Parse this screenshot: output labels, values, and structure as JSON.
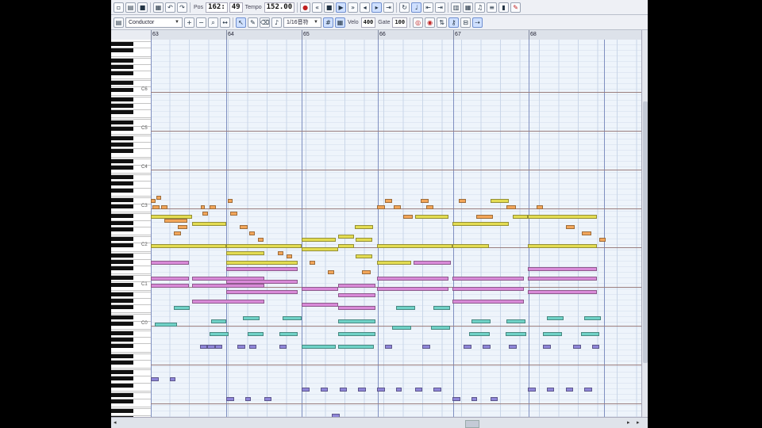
{
  "toolbar_top": {
    "position_label": "Pos",
    "position_value": "162:",
    "beat_value": "49",
    "tempo_label": "Tempo",
    "tempo_value": "152.00",
    "buttons": [
      "new-icon",
      "open-icon",
      "save-icon",
      "print-icon",
      "undo-icon",
      "redo-icon",
      "rewind-icon",
      "play-icon",
      "stop-icon",
      "record-icon",
      "loop-icon",
      "metronome-icon",
      "zoom-icon",
      "settings-icon"
    ]
  },
  "toolbar_second": {
    "track_select": "Conductor",
    "quantize_select": "1/16音符",
    "velocity_label": "Velo",
    "velocity_value": "400",
    "gate_label": "Gate",
    "gate_value": "100"
  },
  "ruler": {
    "measures": [
      "63",
      "64",
      "65",
      "66",
      "67",
      "68"
    ]
  },
  "keyboard": {
    "octave_labels": [
      "C6",
      "C5",
      "C4",
      "C3",
      "C2",
      "C1",
      "C0"
    ]
  },
  "colors": {
    "orange": "#f2a65a",
    "yellow": "#e3dc52",
    "pink": "#d98ad8",
    "teal": "#6fd2c7",
    "purple": "#8f86d8",
    "grid_bg": "#eef4fb",
    "measure_line": "#7f8fc0"
  },
  "notes": [
    {
      "track": "orange",
      "bar": 0.0,
      "len": 0.06,
      "pitch": 63
    },
    {
      "track": "orange",
      "bar": 0.07,
      "len": 0.07,
      "pitch": 64
    },
    {
      "track": "orange",
      "bar": 0.02,
      "len": 0.1,
      "pitch": 61
    },
    {
      "track": "orange",
      "bar": 0.14,
      "len": 0.08,
      "pitch": 61
    },
    {
      "track": "orange",
      "bar": 0.66,
      "len": 0.06,
      "pitch": 61
    },
    {
      "track": "orange",
      "bar": 0.18,
      "len": 0.3,
      "pitch": 57
    },
    {
      "track": "orange",
      "bar": 0.36,
      "len": 0.12,
      "pitch": 55
    },
    {
      "track": "orange",
      "bar": 0.3,
      "len": 0.1,
      "pitch": 53
    },
    {
      "track": "orange",
      "bar": 0.68,
      "len": 0.08,
      "pitch": 59
    },
    {
      "track": "orange",
      "bar": 0.78,
      "len": 0.08,
      "pitch": 61
    },
    {
      "track": "orange",
      "bar": 1.02,
      "len": 0.06,
      "pitch": 63
    },
    {
      "track": "orange",
      "bar": 1.05,
      "len": 0.1,
      "pitch": 59
    },
    {
      "track": "orange",
      "bar": 1.18,
      "len": 0.1,
      "pitch": 55
    },
    {
      "track": "orange",
      "bar": 1.3,
      "len": 0.08,
      "pitch": 53
    },
    {
      "track": "orange",
      "bar": 1.42,
      "len": 0.08,
      "pitch": 51
    },
    {
      "track": "orange",
      "bar": 1.55,
      "len": 0.08,
      "pitch": 49
    },
    {
      "track": "orange",
      "bar": 1.68,
      "len": 0.08,
      "pitch": 47
    },
    {
      "track": "orange",
      "bar": 1.8,
      "len": 0.07,
      "pitch": 46
    },
    {
      "track": "orange",
      "bar": 2.1,
      "len": 0.08,
      "pitch": 44
    },
    {
      "track": "orange",
      "bar": 2.35,
      "len": 0.08,
      "pitch": 41
    },
    {
      "track": "orange",
      "bar": 2.8,
      "len": 0.12,
      "pitch": 41
    },
    {
      "track": "orange",
      "bar": 3.0,
      "len": 0.1,
      "pitch": 61
    },
    {
      "track": "orange",
      "bar": 3.1,
      "len": 0.1,
      "pitch": 63
    },
    {
      "track": "orange",
      "bar": 3.22,
      "len": 0.1,
      "pitch": 61
    },
    {
      "track": "orange",
      "bar": 3.35,
      "len": 0.12,
      "pitch": 58
    },
    {
      "track": "orange",
      "bar": 3.58,
      "len": 0.1,
      "pitch": 63
    },
    {
      "track": "orange",
      "bar": 3.65,
      "len": 0.1,
      "pitch": 61
    },
    {
      "track": "orange",
      "bar": 4.08,
      "len": 0.1,
      "pitch": 63
    },
    {
      "track": "orange",
      "bar": 4.32,
      "len": 0.22,
      "pitch": 58
    },
    {
      "track": "orange",
      "bar": 4.55,
      "len": 0.1,
      "pitch": 56
    },
    {
      "track": "orange",
      "bar": 4.72,
      "len": 0.12,
      "pitch": 61
    },
    {
      "track": "orange",
      "bar": 5.12,
      "len": 0.08,
      "pitch": 61
    },
    {
      "track": "orange",
      "bar": 5.5,
      "len": 0.12,
      "pitch": 55
    },
    {
      "track": "orange",
      "bar": 5.72,
      "len": 0.12,
      "pitch": 53
    },
    {
      "track": "orange",
      "bar": 5.95,
      "len": 0.08,
      "pitch": 51
    },
    {
      "track": "yellow",
      "bar": 0.0,
      "len": 0.55,
      "pitch": 58
    },
    {
      "track": "yellow",
      "bar": 0.55,
      "len": 0.45,
      "pitch": 56
    },
    {
      "track": "yellow",
      "bar": 0.0,
      "len": 1.0,
      "pitch": 49
    },
    {
      "track": "yellow",
      "bar": 1.0,
      "len": 1.0,
      "pitch": 49
    },
    {
      "track": "yellow",
      "bar": 1.0,
      "len": 0.95,
      "pitch": 44
    },
    {
      "track": "yellow",
      "bar": 1.0,
      "len": 0.5,
      "pitch": 47
    },
    {
      "track": "yellow",
      "bar": 2.0,
      "len": 0.45,
      "pitch": 51
    },
    {
      "track": "yellow",
      "bar": 2.48,
      "len": 0.22,
      "pitch": 52
    },
    {
      "track": "yellow",
      "bar": 2.0,
      "len": 0.48,
      "pitch": 48
    },
    {
      "track": "yellow",
      "bar": 2.48,
      "len": 0.22,
      "pitch": 49
    },
    {
      "track": "yellow",
      "bar": 2.7,
      "len": 0.25,
      "pitch": 55
    },
    {
      "track": "yellow",
      "bar": 2.72,
      "len": 0.22,
      "pitch": 51
    },
    {
      "track": "yellow",
      "bar": 2.72,
      "len": 0.22,
      "pitch": 46
    },
    {
      "track": "yellow",
      "bar": 3.0,
      "len": 1.0,
      "pitch": 49
    },
    {
      "track": "yellow",
      "bar": 3.0,
      "len": 0.45,
      "pitch": 44
    },
    {
      "track": "yellow",
      "bar": 3.5,
      "len": 0.45,
      "pitch": 58
    },
    {
      "track": "yellow",
      "bar": 4.0,
      "len": 0.75,
      "pitch": 56
    },
    {
      "track": "yellow",
      "bar": 4.0,
      "len": 0.48,
      "pitch": 49
    },
    {
      "track": "yellow",
      "bar": 4.5,
      "len": 0.25,
      "pitch": 63
    },
    {
      "track": "yellow",
      "bar": 4.8,
      "len": 0.2,
      "pitch": 58
    },
    {
      "track": "yellow",
      "bar": 5.0,
      "len": 0.92,
      "pitch": 58
    },
    {
      "track": "yellow",
      "bar": 5.0,
      "len": 0.92,
      "pitch": 49
    },
    {
      "track": "pink",
      "bar": 0.0,
      "len": 0.5,
      "pitch": 44
    },
    {
      "track": "pink",
      "bar": 0.0,
      "len": 0.5,
      "pitch": 39
    },
    {
      "track": "pink",
      "bar": 0.0,
      "len": 0.5,
      "pitch": 37
    },
    {
      "track": "pink",
      "bar": 0.55,
      "len": 0.95,
      "pitch": 39
    },
    {
      "track": "pink",
      "bar": 0.55,
      "len": 0.95,
      "pitch": 37
    },
    {
      "track": "pink",
      "bar": 0.55,
      "len": 0.95,
      "pitch": 32
    },
    {
      "track": "pink",
      "bar": 1.0,
      "len": 0.95,
      "pitch": 42
    },
    {
      "track": "pink",
      "bar": 1.0,
      "len": 0.95,
      "pitch": 38
    },
    {
      "track": "pink",
      "bar": 1.0,
      "len": 0.95,
      "pitch": 35
    },
    {
      "track": "pink",
      "bar": 2.0,
      "len": 0.48,
      "pitch": 36
    },
    {
      "track": "pink",
      "bar": 2.0,
      "len": 0.48,
      "pitch": 31
    },
    {
      "track": "pink",
      "bar": 2.48,
      "len": 0.5,
      "pitch": 37
    },
    {
      "track": "pink",
      "bar": 2.48,
      "len": 0.5,
      "pitch": 34
    },
    {
      "track": "pink",
      "bar": 2.48,
      "len": 0.5,
      "pitch": 30
    },
    {
      "track": "pink",
      "bar": 3.0,
      "len": 0.95,
      "pitch": 39
    },
    {
      "track": "pink",
      "bar": 3.0,
      "len": 0.95,
      "pitch": 36
    },
    {
      "track": "pink",
      "bar": 3.48,
      "len": 0.5,
      "pitch": 44
    },
    {
      "track": "pink",
      "bar": 4.0,
      "len": 0.95,
      "pitch": 39
    },
    {
      "track": "pink",
      "bar": 4.0,
      "len": 0.95,
      "pitch": 36
    },
    {
      "track": "pink",
      "bar": 4.0,
      "len": 0.95,
      "pitch": 32
    },
    {
      "track": "pink",
      "bar": 5.0,
      "len": 0.92,
      "pitch": 42
    },
    {
      "track": "pink",
      "bar": 5.0,
      "len": 0.92,
      "pitch": 39
    },
    {
      "track": "pink",
      "bar": 5.0,
      "len": 0.92,
      "pitch": 35
    },
    {
      "track": "teal",
      "bar": 0.3,
      "len": 0.22,
      "pitch": 30
    },
    {
      "track": "teal",
      "bar": 0.05,
      "len": 0.3,
      "pitch": 25
    },
    {
      "track": "teal",
      "bar": 0.8,
      "len": 0.2,
      "pitch": 26
    },
    {
      "track": "teal",
      "bar": 0.78,
      "len": 0.25,
      "pitch": 22
    },
    {
      "track": "teal",
      "bar": 1.22,
      "len": 0.22,
      "pitch": 27
    },
    {
      "track": "teal",
      "bar": 1.28,
      "len": 0.22,
      "pitch": 22
    },
    {
      "track": "teal",
      "bar": 1.75,
      "len": 0.25,
      "pitch": 27
    },
    {
      "track": "teal",
      "bar": 1.7,
      "len": 0.25,
      "pitch": 22
    },
    {
      "track": "teal",
      "bar": 2.0,
      "len": 0.45,
      "pitch": 18
    },
    {
      "track": "teal",
      "bar": 2.48,
      "len": 0.5,
      "pitch": 26
    },
    {
      "track": "teal",
      "bar": 2.48,
      "len": 0.5,
      "pitch": 22
    },
    {
      "track": "teal",
      "bar": 2.48,
      "len": 0.48,
      "pitch": 18
    },
    {
      "track": "teal",
      "bar": 3.25,
      "len": 0.25,
      "pitch": 30
    },
    {
      "track": "teal",
      "bar": 3.2,
      "len": 0.25,
      "pitch": 24
    },
    {
      "track": "teal",
      "bar": 3.75,
      "len": 0.22,
      "pitch": 30
    },
    {
      "track": "teal",
      "bar": 3.72,
      "len": 0.25,
      "pitch": 24
    },
    {
      "track": "teal",
      "bar": 4.25,
      "len": 0.25,
      "pitch": 26
    },
    {
      "track": "teal",
      "bar": 4.22,
      "len": 0.28,
      "pitch": 22
    },
    {
      "track": "teal",
      "bar": 4.72,
      "len": 0.25,
      "pitch": 26
    },
    {
      "track": "teal",
      "bar": 4.7,
      "len": 0.28,
      "pitch": 22
    },
    {
      "track": "teal",
      "bar": 5.25,
      "len": 0.22,
      "pitch": 27
    },
    {
      "track": "teal",
      "bar": 5.2,
      "len": 0.25,
      "pitch": 22
    },
    {
      "track": "teal",
      "bar": 5.75,
      "len": 0.22,
      "pitch": 27
    },
    {
      "track": "teal",
      "bar": 5.7,
      "len": 0.25,
      "pitch": 22
    },
    {
      "track": "purple",
      "bar": 0.0,
      "len": 0.1,
      "pitch": 8
    },
    {
      "track": "purple",
      "bar": 0.25,
      "len": 0.08,
      "pitch": 8
    },
    {
      "track": "purple",
      "bar": 0.65,
      "len": 0.1,
      "pitch": 18
    },
    {
      "track": "purple",
      "bar": 0.75,
      "len": 0.1,
      "pitch": 18
    },
    {
      "track": "purple",
      "bar": 0.85,
      "len": 0.1,
      "pitch": 18
    },
    {
      "track": "purple",
      "bar": 1.0,
      "len": 0.1,
      "pitch": 2
    },
    {
      "track": "purple",
      "bar": 1.25,
      "len": 0.08,
      "pitch": 2
    },
    {
      "track": "purple",
      "bar": 1.5,
      "len": 0.1,
      "pitch": 2
    },
    {
      "track": "purple",
      "bar": 1.15,
      "len": 0.1,
      "pitch": 18
    },
    {
      "track": "purple",
      "bar": 1.3,
      "len": 0.1,
      "pitch": 18
    },
    {
      "track": "purple",
      "bar": 1.7,
      "len": 0.1,
      "pitch": 18
    },
    {
      "track": "purple",
      "bar": 2.0,
      "len": 0.1,
      "pitch": 5
    },
    {
      "track": "purple",
      "bar": 2.25,
      "len": 0.1,
      "pitch": 5
    },
    {
      "track": "purple",
      "bar": 2.5,
      "len": 0.1,
      "pitch": 5
    },
    {
      "track": "purple",
      "bar": 2.75,
      "len": 0.1,
      "pitch": 5
    },
    {
      "track": "purple",
      "bar": 2.0,
      "len": 0.12,
      "pitch": -6
    },
    {
      "track": "purple",
      "bar": 2.4,
      "len": 0.1,
      "pitch": -3
    },
    {
      "track": "purple",
      "bar": 3.0,
      "len": 0.1,
      "pitch": 5
    },
    {
      "track": "purple",
      "bar": 3.25,
      "len": 0.08,
      "pitch": 5
    },
    {
      "track": "purple",
      "bar": 3.5,
      "len": 0.1,
      "pitch": 5
    },
    {
      "track": "purple",
      "bar": 3.75,
      "len": 0.1,
      "pitch": 5
    },
    {
      "track": "purple",
      "bar": 3.1,
      "len": 0.1,
      "pitch": 18
    },
    {
      "track": "purple",
      "bar": 3.6,
      "len": 0.1,
      "pitch": 18
    },
    {
      "track": "purple",
      "bar": 4.0,
      "len": 0.1,
      "pitch": 2
    },
    {
      "track": "purple",
      "bar": 4.25,
      "len": 0.08,
      "pitch": 2
    },
    {
      "track": "purple",
      "bar": 4.5,
      "len": 0.1,
      "pitch": 2
    },
    {
      "track": "purple",
      "bar": 4.15,
      "len": 0.1,
      "pitch": 18
    },
    {
      "track": "purple",
      "bar": 4.4,
      "len": 0.1,
      "pitch": 18
    },
    {
      "track": "purple",
      "bar": 4.75,
      "len": 0.1,
      "pitch": 18
    },
    {
      "track": "purple",
      "bar": 5.0,
      "len": 0.1,
      "pitch": 5
    },
    {
      "track": "purple",
      "bar": 5.25,
      "len": 0.1,
      "pitch": 5
    },
    {
      "track": "purple",
      "bar": 5.5,
      "len": 0.1,
      "pitch": 5
    },
    {
      "track": "purple",
      "bar": 5.75,
      "len": 0.1,
      "pitch": 5
    },
    {
      "track": "purple",
      "bar": 5.2,
      "len": 0.1,
      "pitch": 18
    },
    {
      "track": "purple",
      "bar": 5.6,
      "len": 0.1,
      "pitch": 18
    },
    {
      "track": "purple",
      "bar": 5.85,
      "len": 0.1,
      "pitch": 18
    }
  ]
}
